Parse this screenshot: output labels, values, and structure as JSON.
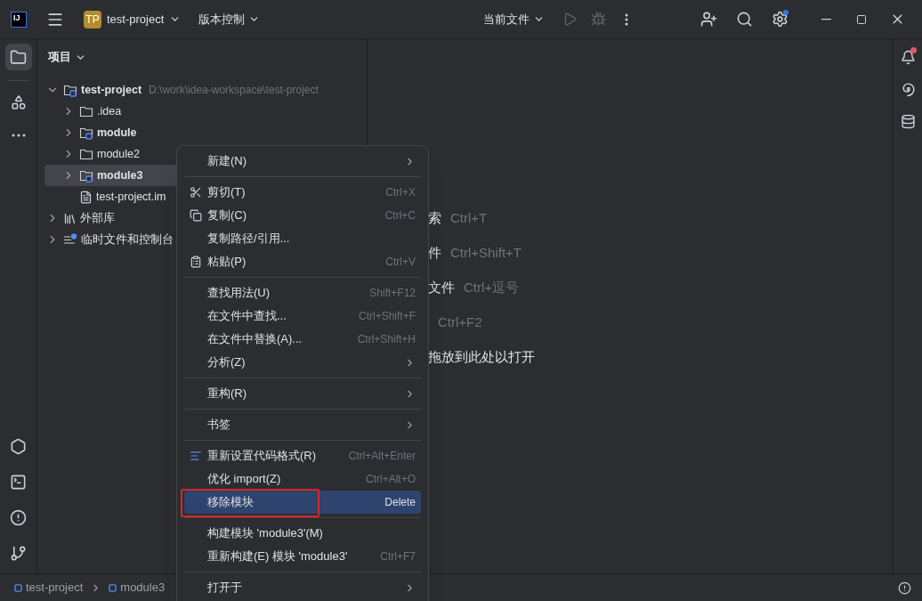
{
  "toolbar": {
    "logo_text": "IJ",
    "project_badge": "TP",
    "project_name": "test-project",
    "vcs": "版本控制",
    "run_config": "当前文件",
    "settings_update": true
  },
  "right_strip": {
    "notifications": true
  },
  "project_panel": {
    "title": "项目",
    "tree": [
      {
        "name": "test-project",
        "path": "D:\\work\\idea-workspace\\test-project",
        "kind": "module",
        "bold": true,
        "expanded": true,
        "selected": false,
        "children": [
          {
            "name": ".idea",
            "kind": "folder",
            "bold": false,
            "expanded": false,
            "selected": false
          },
          {
            "name": "module",
            "kind": "module",
            "bold": true,
            "expanded": false,
            "selected": false
          },
          {
            "name": "module2",
            "kind": "folder",
            "bold": false,
            "expanded": false,
            "selected": false
          },
          {
            "name": "module3",
            "kind": "module",
            "bold": true,
            "expanded": false,
            "selected": true
          },
          {
            "name": "test-project.im",
            "kind": "file",
            "bold": false,
            "selected": false
          }
        ]
      },
      {
        "name": "外部库",
        "kind": "library",
        "bold": false,
        "expanded": false,
        "selected": false
      },
      {
        "name": "临时文件和控制台",
        "kind": "scratch",
        "bold": false,
        "expanded": false,
        "selected": false
      }
    ]
  },
  "editor_hints": [
    {
      "action": "索",
      "shortcut": "Ctrl+T"
    },
    {
      "action": "件",
      "shortcut": "Ctrl+Shift+T"
    },
    {
      "action": "文件",
      "shortcut": "Ctrl+逗号"
    },
    {
      "shortcut": "Ctrl+F2"
    },
    {
      "action": "拖放到此处以打开"
    }
  ],
  "context_menu": {
    "groups": [
      [
        {
          "label": "新建(N)",
          "kind": "plain",
          "submenu": true,
          "selected": false,
          "annotated": false
        }
      ],
      [
        {
          "label": "剪切(T)",
          "kind": "cut",
          "shortcut": "Ctrl+X",
          "submenu": false,
          "selected": false,
          "annotated": false
        },
        {
          "label": "复制(C)",
          "kind": "copy",
          "shortcut": "Ctrl+C",
          "submenu": false,
          "selected": false,
          "annotated": false
        },
        {
          "label": "复制路径/引用...",
          "kind": "plain",
          "submenu": false,
          "selected": false,
          "annotated": false
        },
        {
          "label": "粘贴(P)",
          "kind": "paste",
          "shortcut": "Ctrl+V",
          "submenu": false,
          "selected": false,
          "annotated": false
        }
      ],
      [
        {
          "label": "查找用法(U)",
          "kind": "plain",
          "shortcut": "Shift+F12",
          "submenu": false,
          "selected": false,
          "annotated": false
        },
        {
          "label": "在文件中查找...",
          "kind": "plain",
          "shortcut": "Ctrl+Shift+F",
          "submenu": false,
          "selected": false,
          "annotated": false
        },
        {
          "label": "在文件中替换(A)...",
          "kind": "plain",
          "shortcut": "Ctrl+Shift+H",
          "submenu": false,
          "selected": false,
          "annotated": false
        },
        {
          "label": "分析(Z)",
          "kind": "plain",
          "submenu": true,
          "selected": false,
          "annotated": false
        }
      ],
      [
        {
          "label": "重构(R)",
          "kind": "plain",
          "submenu": true,
          "selected": false,
          "annotated": false
        }
      ],
      [
        {
          "label": "书签",
          "kind": "plain",
          "submenu": true,
          "selected": false,
          "annotated": false
        }
      ],
      [
        {
          "label": "重新设置代码格式(R)",
          "kind": "reformat",
          "shortcut": "Ctrl+Alt+Enter",
          "submenu": false,
          "selected": false,
          "annotated": false
        },
        {
          "label": "优化 import(Z)",
          "kind": "plain",
          "shortcut": "Ctrl+Alt+O",
          "submenu": false,
          "selected": false,
          "annotated": false
        },
        {
          "label": "移除模块",
          "kind": "plain",
          "shortcut": "Delete",
          "submenu": false,
          "selected": true,
          "annotated": true
        }
      ],
      [
        {
          "label": "构建模块 'module3'(M)",
          "kind": "plain",
          "submenu": false,
          "selected": false,
          "annotated": false
        },
        {
          "label": "重新构建(E) 模块 'module3'",
          "kind": "plain",
          "shortcut": "Ctrl+F7",
          "submenu": false,
          "selected": false,
          "annotated": false
        }
      ],
      [
        {
          "label": "打开于",
          "kind": "plain",
          "submenu": true,
          "selected": false,
          "annotated": false
        }
      ]
    ]
  },
  "breadcrumbs": [
    {
      "label": "test-project"
    },
    {
      "label": "module3"
    }
  ]
}
